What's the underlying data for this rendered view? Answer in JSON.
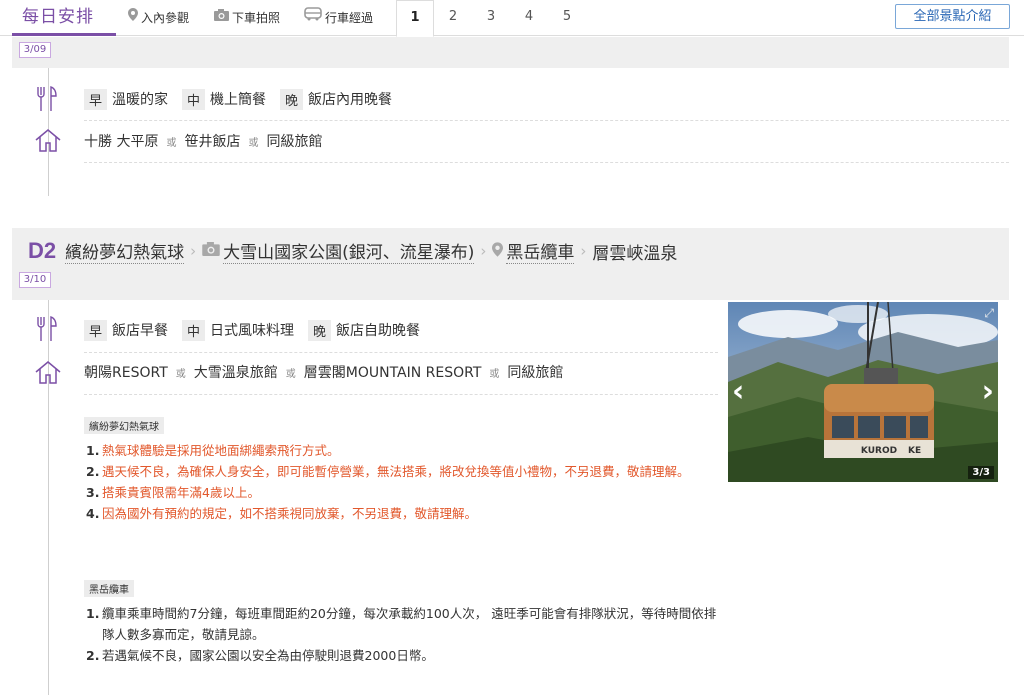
{
  "tabs": {
    "title": "每日安排",
    "legend": [
      {
        "icon": "map-pin-icon",
        "label": "入內參觀"
      },
      {
        "icon": "camera-icon",
        "label": "下車拍照"
      },
      {
        "icon": "bus-icon",
        "label": "行車經過"
      }
    ],
    "days": [
      "1",
      "2",
      "3",
      "4",
      "5"
    ],
    "active_day": "1",
    "all_spots_button": "全部景點介紹"
  },
  "day1": {
    "date": "3/09",
    "meals": [
      {
        "tag": "早",
        "text": "溫暖的家"
      },
      {
        "tag": "中",
        "text": "機上簡餐"
      },
      {
        "tag": "晚",
        "text": "飯店內用晚餐"
      }
    ],
    "hotels": [
      "十勝 大平原",
      "笹井飯店",
      "同級旅館"
    ],
    "or": "或"
  },
  "day2": {
    "label": "D2",
    "date": "3/10",
    "route": [
      {
        "icon": "",
        "name": "繽紛夢幻熱氣球"
      },
      {
        "icon": "camera-icon",
        "name": "大雪山國家公園(銀河、流星瀑布)"
      },
      {
        "icon": "map-pin-icon",
        "name": "黑岳纜車"
      },
      {
        "icon": "",
        "name": "層雲峽溫泉"
      }
    ],
    "meals": [
      {
        "tag": "早",
        "text": "飯店早餐"
      },
      {
        "tag": "中",
        "text": "日式風味料理"
      },
      {
        "tag": "晚",
        "text": "飯店自助晚餐"
      }
    ],
    "hotels": [
      "朝陽RESORT",
      "大雪溫泉旅館",
      "層雲閣MOUNTAIN RESORT",
      "同級旅館"
    ],
    "or": "或",
    "photo_counter": "3/3",
    "photo_brand": "KUROD",
    "photo_brand_suffix": "KE",
    "notes1": {
      "title": "繽紛夢幻熱氣球",
      "items": [
        {
          "num": "1.",
          "text": "熱氣球體驗是採用從地面綁繩索飛行方式。"
        },
        {
          "num": "2.",
          "text": "遇天候不良，為確保人身安全，即可能暫停營業，無法搭乘，將改兌換等值小禮物，不另退費，敬請理解。"
        },
        {
          "num": "3.",
          "text": "搭乘貴賓限需年滿4歲以上。"
        },
        {
          "num": "4.",
          "text": "因為國外有預約的規定，如不搭乘視同放棄，不另退費，敬請理解。"
        }
      ]
    },
    "notes2": {
      "title": "黑岳纜車",
      "items": [
        {
          "num": "1.",
          "text": "纜車乘車時間約7分鐘，每班車間距約20分鐘，每次承載約100人次， 遠旺季可能會有排隊狀況，等待時間依排隊人數多寡而定，敬請見諒。"
        },
        {
          "num": "2.",
          "text": "若遇氣候不良，國家公園以安全為由停駛則退費2000日幣。"
        }
      ]
    }
  }
}
